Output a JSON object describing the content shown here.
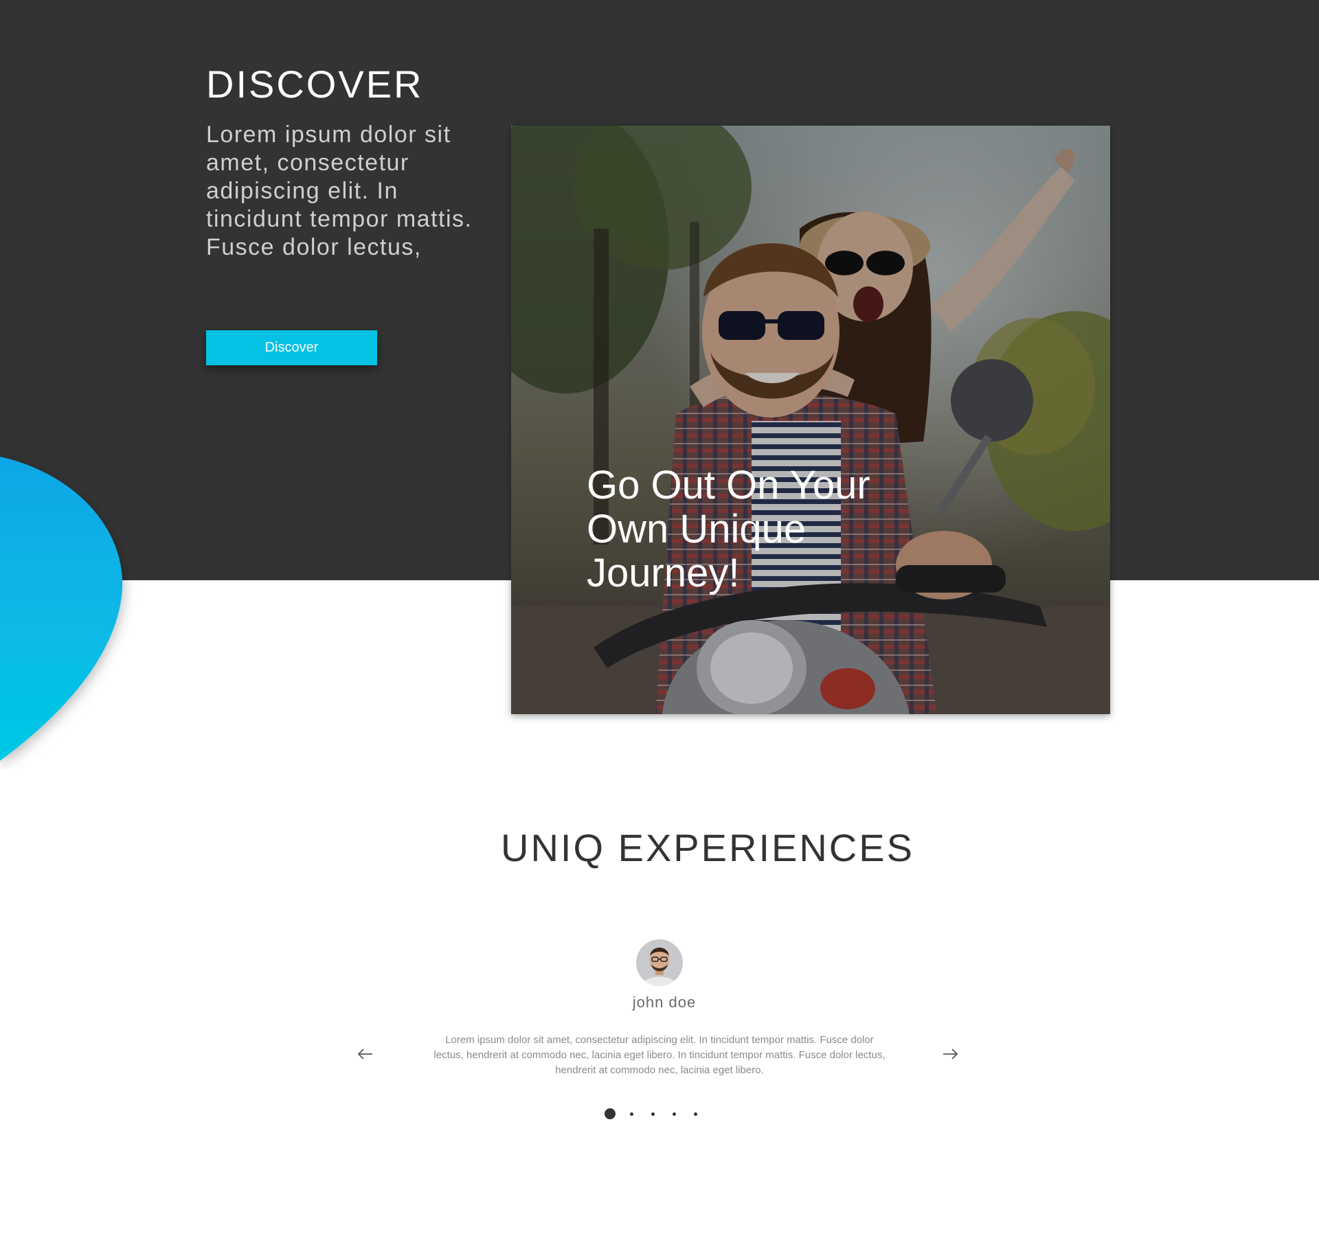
{
  "hero": {
    "title": "DISCOVER",
    "text": "Lorem ipsum dolor sit amet, consectetur adipiscing elit. In tincidunt tempor mattis. Fusce dolor lectus,",
    "button_label": "Discover"
  },
  "feature": {
    "caption": "Go Out On Your Own Unique Journey!",
    "image_description": "couple-riding-scooter-photo"
  },
  "experiences": {
    "title": "UNIQ EXPERIENCES",
    "testimonial": {
      "author": "john doe",
      "text": "Lorem ipsum dolor sit amet, consectetur adipiscing elit. In tincidunt tempor mattis. Fusce dolor lectus, hendrerit at commodo nec, lacinia eget libero. In tincidunt tempor mattis. Fusce dolor lectus, hendrerit at commodo nec, lacinia eget libero."
    },
    "pagination": {
      "total": 5,
      "active_index": 0
    },
    "nav": {
      "prev_icon": "arrow-left-icon",
      "next_icon": "arrow-right-icon"
    }
  },
  "colors": {
    "hero_background": "#333333",
    "accent": "#05c2e4",
    "blob_gradient_start": "#0aa6e6",
    "blob_gradient_end": "#05c8e5"
  }
}
